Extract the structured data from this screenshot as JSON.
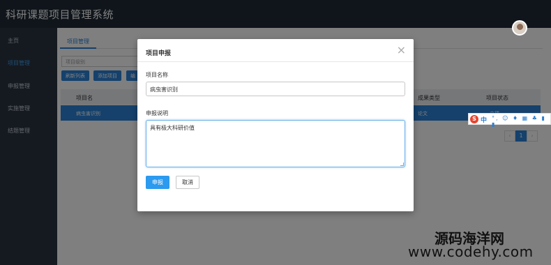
{
  "app": {
    "title": "科研课题项目管理系统"
  },
  "sidebar": {
    "items": [
      {
        "label": "主页",
        "active": false
      },
      {
        "label": "项目管理",
        "active": true
      },
      {
        "label": "申报管理",
        "active": false
      },
      {
        "label": "实施管理",
        "active": false
      },
      {
        "label": "结题管理",
        "active": false
      }
    ]
  },
  "main": {
    "tab": "项目管理",
    "search_placeholder": "项目级别",
    "buttons": [
      "刷新列表",
      "添加项目",
      "编"
    ],
    "table": {
      "headers": [
        "项目名",
        "成果类型",
        "项目状态"
      ],
      "rows": [
        {
          "name": "病虫害识别",
          "result_type": "论文",
          "status": "立项"
        }
      ]
    },
    "pagination": {
      "prev": "‹",
      "current": "1",
      "next": "›"
    }
  },
  "modal": {
    "title": "项目申报",
    "close_glyph": "×",
    "name_label": "项目名称",
    "name_value": "病虫害识别",
    "desc_label": "申报说明",
    "desc_value": "具有极大科研价值",
    "submit_label": "申报",
    "cancel_label": "取消"
  },
  "ime_toolbar": {
    "logo": "S",
    "mode": "中",
    "icons": "°, ☺ ♦ ▦ ♣ ▮ ▮"
  },
  "watermark": {
    "line1": "源码海洋网",
    "line2": "www.codehy.com"
  },
  "colors": {
    "header": "#1f2a37",
    "sidebar": "#2a3542",
    "accent": "#2b82d9",
    "primary_button": "#2b9aef"
  }
}
